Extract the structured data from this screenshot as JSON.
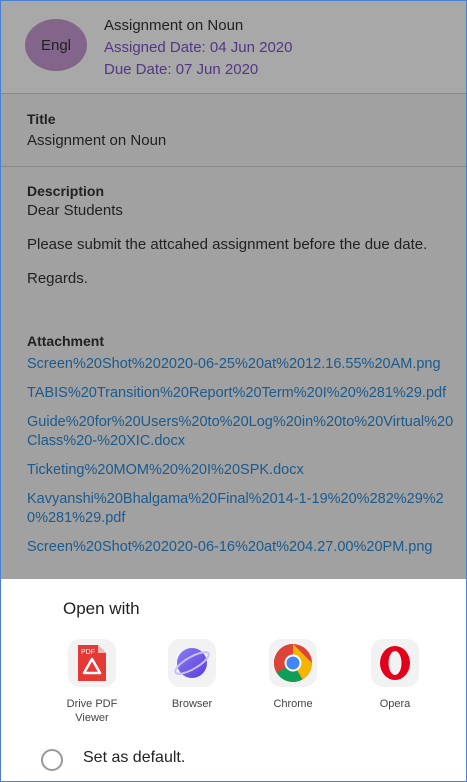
{
  "header": {
    "avatar_text": "Engl",
    "title": "Assignment on Noun",
    "assigned": "Assigned Date: 04 Jun 2020",
    "due": "Due Date: 07 Jun 2020"
  },
  "title_section": {
    "label": "Title",
    "value": "Assignment on Noun"
  },
  "description": {
    "label": "Description",
    "line1": "Dear Students",
    "line2": "Please submit the attcahed assignment before the due date.",
    "line3": "Regards."
  },
  "attachments": {
    "label": "Attachment",
    "items": [
      "Screen%20Shot%202020-06-25%20at%2012.16.55%20AM.png",
      "TABIS%20Transition%20Report%20Term%20I%20%281%29.pdf",
      "Guide%20for%20Users%20to%20Log%20in%20to%20Virtual%20Class%20-%20XIC.docx",
      "Ticketing%20MOM%20%20I%20SPK.docx",
      "Kavyanshi%20Bhalgama%20Final%2014-1-19%20%282%29%20%281%29.pdf",
      "Screen%20Shot%202020-06-16%20at%204.27.00%20PM.png"
    ]
  },
  "sheet": {
    "title": "Open with",
    "apps": [
      {
        "label": "Drive PDF Viewer",
        "icon": "drive-pdf-icon",
        "badge": "PDF"
      },
      {
        "label": "Browser",
        "icon": "browser-icon"
      },
      {
        "label": "Chrome",
        "icon": "chrome-icon"
      },
      {
        "label": "Opera",
        "icon": "opera-icon"
      }
    ],
    "default_label": "Set as default."
  },
  "colors": {
    "accent_purple": "#7b55c9",
    "link_blue": "#2b8ad8",
    "avatar_bg": "#c79ad3"
  }
}
